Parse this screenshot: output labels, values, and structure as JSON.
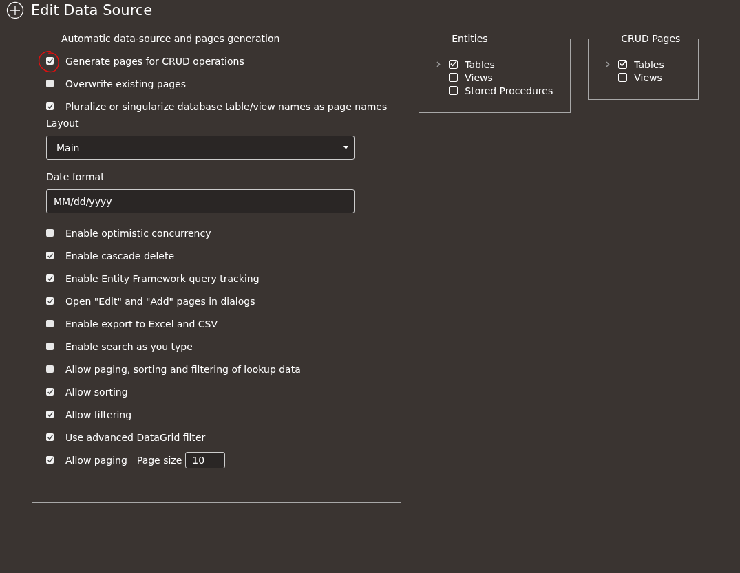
{
  "title": "Edit Data Source",
  "generation": {
    "legend": "Automatic data-source and pages generation",
    "top_options": [
      {
        "label": "Generate pages for CRUD operations",
        "checked": true,
        "highlighted": true
      },
      {
        "label": "Overwrite existing pages",
        "checked": false,
        "highlighted": false
      },
      {
        "label": "Pluralize or singularize database table/view names as page names",
        "checked": true,
        "highlighted": false
      }
    ],
    "layout": {
      "label": "Layout",
      "value": "Main"
    },
    "date_format": {
      "label": "Date format",
      "value": "MM/dd/yyyy"
    },
    "options": [
      {
        "label": "Enable optimistic concurrency",
        "checked": false
      },
      {
        "label": "Enable cascade delete",
        "checked": true
      },
      {
        "label": "Enable Entity Framework query tracking",
        "checked": true
      },
      {
        "label": "Open \"Edit\" and \"Add\" pages in dialogs",
        "checked": true
      },
      {
        "label": "Enable export to Excel and CSV",
        "checked": false
      },
      {
        "label": "Enable search as you type",
        "checked": false
      },
      {
        "label": "Allow paging, sorting and filtering of lookup data",
        "checked": false
      },
      {
        "label": "Allow sorting",
        "checked": true
      },
      {
        "label": "Allow filtering",
        "checked": true
      },
      {
        "label": "Use advanced DataGrid filter",
        "checked": true
      }
    ],
    "paging": {
      "label": "Allow paging",
      "checked": true,
      "page_size_label": "Page size",
      "page_size": "10"
    }
  },
  "trees": [
    {
      "legend": "Entities",
      "items": [
        {
          "label": "Tables",
          "checked": true,
          "expandable": true
        },
        {
          "label": "Views",
          "checked": false,
          "expandable": false
        },
        {
          "label": "Stored Procedures",
          "checked": false,
          "expandable": false
        }
      ]
    },
    {
      "legend": "CRUD Pages",
      "items": [
        {
          "label": "Tables",
          "checked": true,
          "expandable": true
        },
        {
          "label": "Views",
          "checked": false,
          "expandable": false
        }
      ]
    }
  ]
}
